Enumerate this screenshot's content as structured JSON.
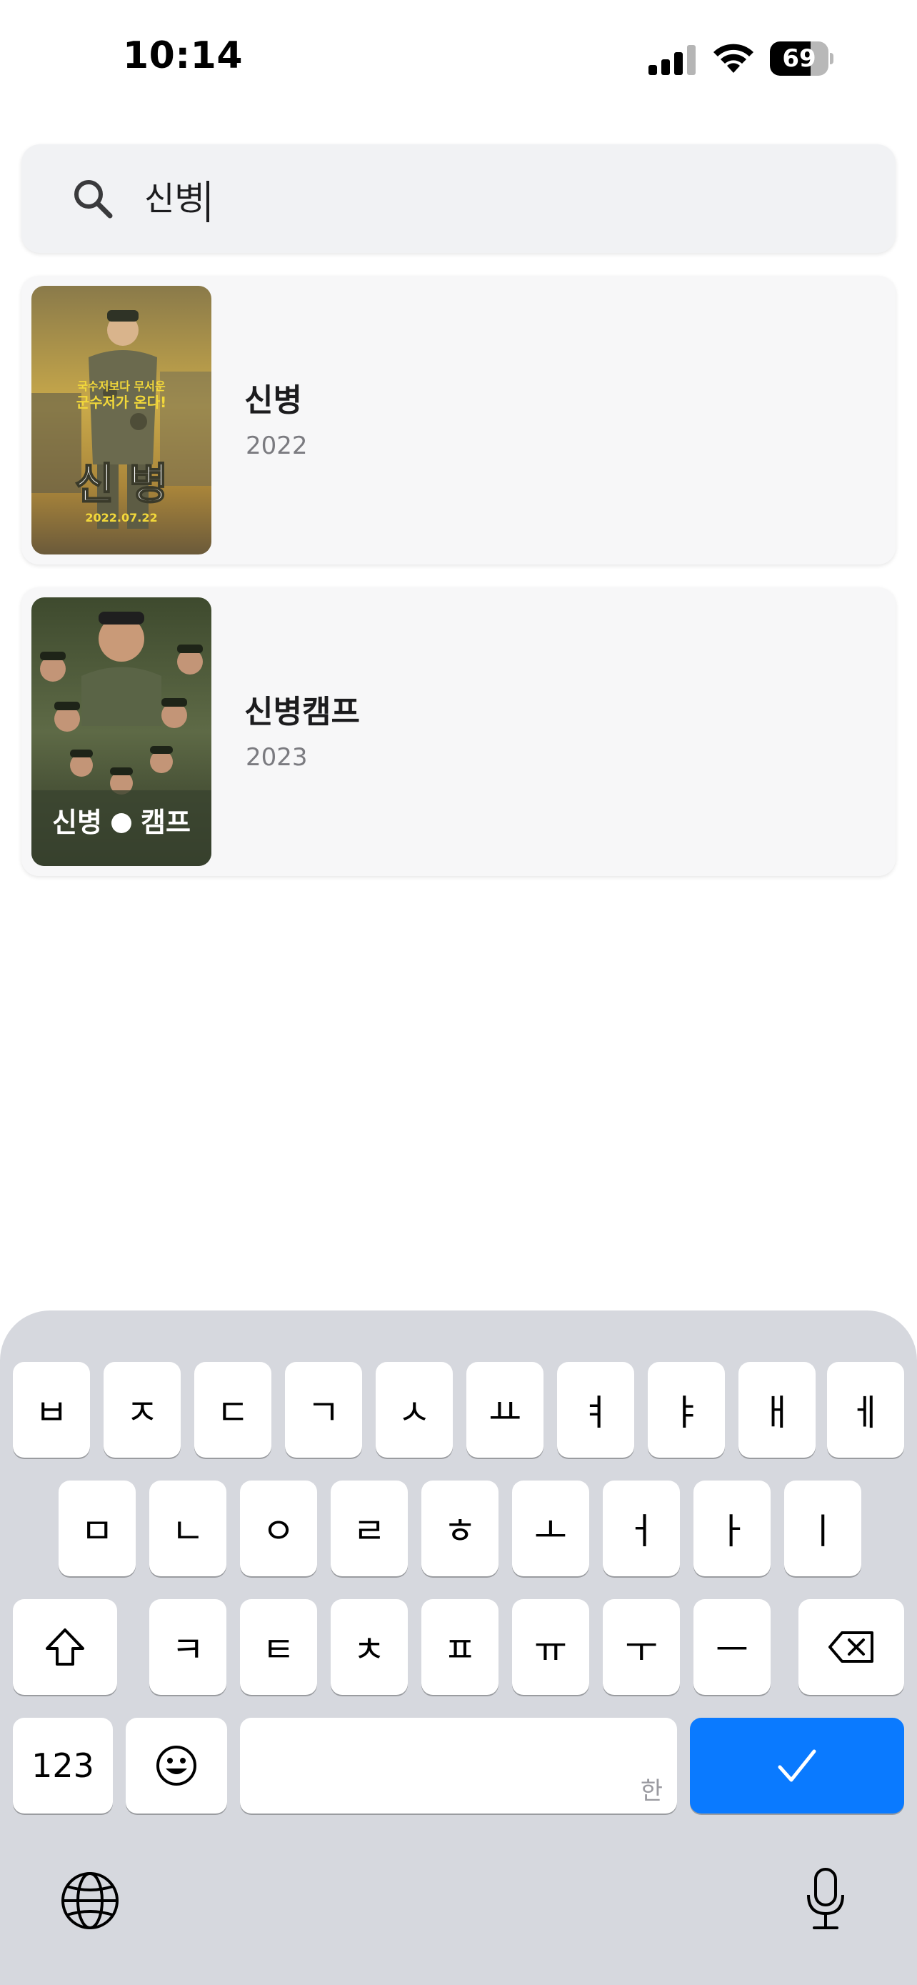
{
  "status": {
    "time": "10:14",
    "battery": "69",
    "battery_level": 0.69
  },
  "search": {
    "value": "신병"
  },
  "results": [
    {
      "title": "신병",
      "year": "2022",
      "poster": {
        "line1": "국수저보다 무서운",
        "line2": "군수저가 온다!",
        "big_title": "신 병",
        "date": "2022.07.22"
      }
    },
    {
      "title": "신병캠프",
      "year": "2023",
      "poster": {
        "big_title_left": "신병",
        "big_title_right": "캠프"
      }
    }
  ],
  "keyboard": {
    "row1": [
      "ㅂ",
      "ㅈ",
      "ㄷ",
      "ㄱ",
      "ㅅ",
      "ㅛ",
      "ㅕ",
      "ㅑ",
      "ㅐ",
      "ㅔ"
    ],
    "row2": [
      "ㅁ",
      "ㄴ",
      "ㅇ",
      "ㄹ",
      "ㅎ",
      "ㅗ",
      "ㅓ",
      "ㅏ",
      "ㅣ"
    ],
    "row3": [
      "ㅋ",
      "ㅌ",
      "ㅊ",
      "ㅍ",
      "ㅠ",
      "ㅜ",
      "ㅡ"
    ],
    "numbers_label": "123",
    "space_hint": "한",
    "icons": {
      "shift": "shift-icon",
      "delete": "backspace-icon",
      "emoji": "emoji-icon",
      "done": "checkmark-icon",
      "globe": "globe-icon",
      "mic": "microphone-icon"
    },
    "accent_color": "#0a7aff"
  }
}
